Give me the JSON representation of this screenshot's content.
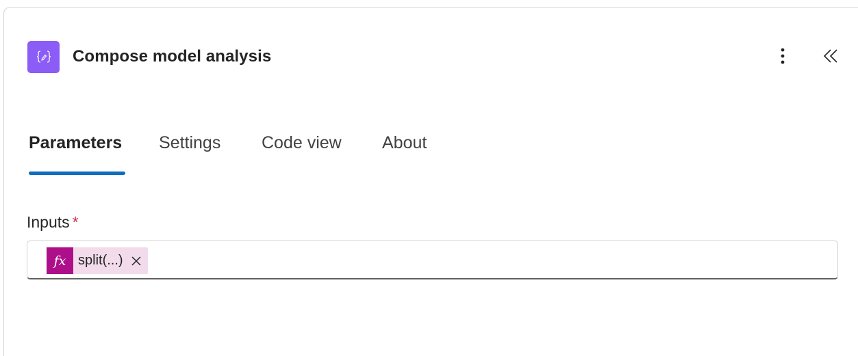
{
  "header": {
    "title": "Compose model analysis",
    "action_icon": "compose-braces-icon",
    "menu_icon": "more-vertical-icon",
    "collapse_icon": "double-chevron-left-icon",
    "action_color": "#8b5cf6"
  },
  "tabs": [
    {
      "label": "Parameters",
      "active": true
    },
    {
      "label": "Settings",
      "active": false
    },
    {
      "label": "Code view",
      "active": false
    },
    {
      "label": "About",
      "active": false
    }
  ],
  "inputs_field": {
    "label": "Inputs",
    "required_marker": "*",
    "token": {
      "icon_text": "fx",
      "label": "split(...)",
      "remove_icon": "close-icon",
      "icon_color": "#ad0f8a",
      "background_color": "#f2dbeb"
    }
  },
  "colors": {
    "accent": "#0f6cbd",
    "required": "#c4314b"
  }
}
